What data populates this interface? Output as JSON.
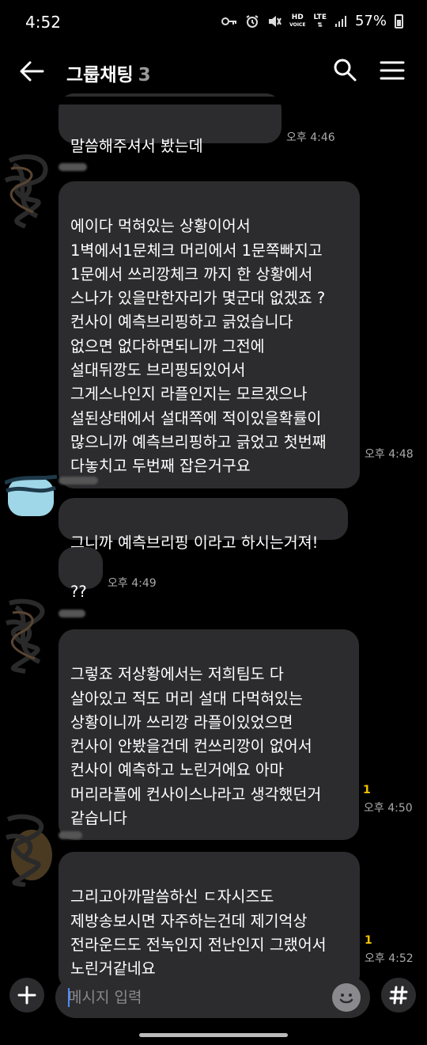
{
  "status_bar": {
    "time": "4:52",
    "hd_label": "HD",
    "voice_label": "VOICE",
    "lte_label": "LTE",
    "battery": "57%"
  },
  "header": {
    "title": "그룹채팅",
    "member_count": "3",
    "back_icon": "arrow-left-icon",
    "search_icon": "search-icon",
    "menu_icon": "hamburger-menu-icon"
  },
  "messages": [
    {
      "text": "말씀해주셔서 봤는데",
      "time": "오후 4:46",
      "unread": ""
    },
    {
      "text": "에이다 먹혀있는 상황이어서\n1벽에서1문체크 머리에서 1문쪽빠지고\n1문에서 쓰리깡체크 까지 한 상황에서\n스나가 있을만한자리가 몇군대 없겠죠 ?\n컨사이 예측브리핑하고 긁었습니다\n없으면 없다하면되니까 그전에\n설대뒤깡도 브리핑되있어서\n그게스나인지 라플인지는 모르겠으나\n설된상태에서 설대쪽에 적이있을확률이\n많으니까 예측브리핑하고 긁었고 첫번째\n다놓치고 두번째 잡은거구요",
      "time": "오후 4:48",
      "unread": ""
    },
    {
      "text": "그니까 예측브리핑 이라고 하시는거져!",
      "time": "",
      "unread": ""
    },
    {
      "text": "??",
      "time": "오후 4:49",
      "unread": ""
    },
    {
      "text": "그렇죠 저상황에서는 저희팀도 다\n살아있고 적도 머리 설대 다먹혀있는\n상황이니까 쓰리깡 라플이있었으면\n컨사이 안봤을건데 컨쓰리깡이 없어서\n컨사이 예측하고 노린거에요 아마\n머리라플에 컨사이스나라고 생각했던거\n같습니다",
      "time": "오후 4:50",
      "unread": "1"
    },
    {
      "text": "그리고아까말씀하신 ㄷ자시즈도\n제방송보시면 자주하는건데 제기억상\n전라운드도 전녹인지 전난인지 그랬어서\n노린거같네요",
      "time": "오후 4:52",
      "unread": "1"
    }
  ],
  "input": {
    "placeholder": "메시지 입력",
    "plus_icon": "plus-icon",
    "emoji_icon": "emoji-icon",
    "hash_icon": "hash-icon"
  }
}
